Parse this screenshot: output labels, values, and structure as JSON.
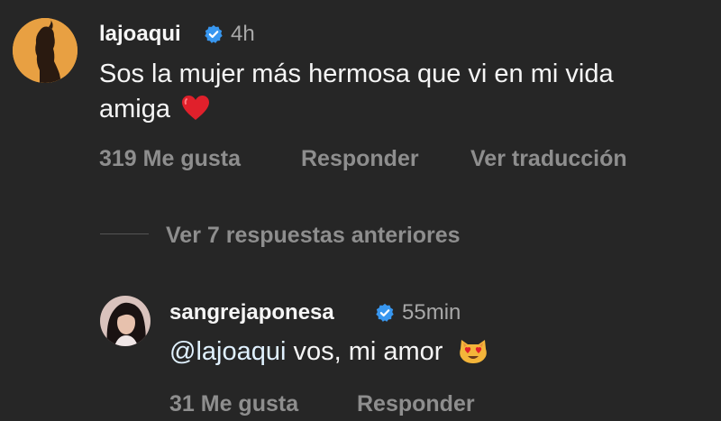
{
  "comment": {
    "username": "lajoaqui",
    "time": "4h",
    "text_line1": "Sos la mujer más hermosa que vi en mi vida",
    "text_line2": "amiga",
    "emoji": "❤️",
    "likes": "319 Me gusta",
    "reply": "Responder",
    "translate": "Ver traducción"
  },
  "view_replies": "Ver 7 respuestas anteriores",
  "reply_comment": {
    "username": "sangrejaponesa",
    "time": "55min",
    "mention": "@lajoaqui",
    "text": " vos, mi amor",
    "emoji": "😻",
    "likes": "31 Me gusta",
    "reply": "Responder"
  },
  "colors": {
    "background": "#262626",
    "verified": "#3897f0",
    "muted": "#8e8e8e",
    "avatar_main": "#e8a042"
  },
  "icons": {
    "verified": "verified-badge-icon"
  }
}
